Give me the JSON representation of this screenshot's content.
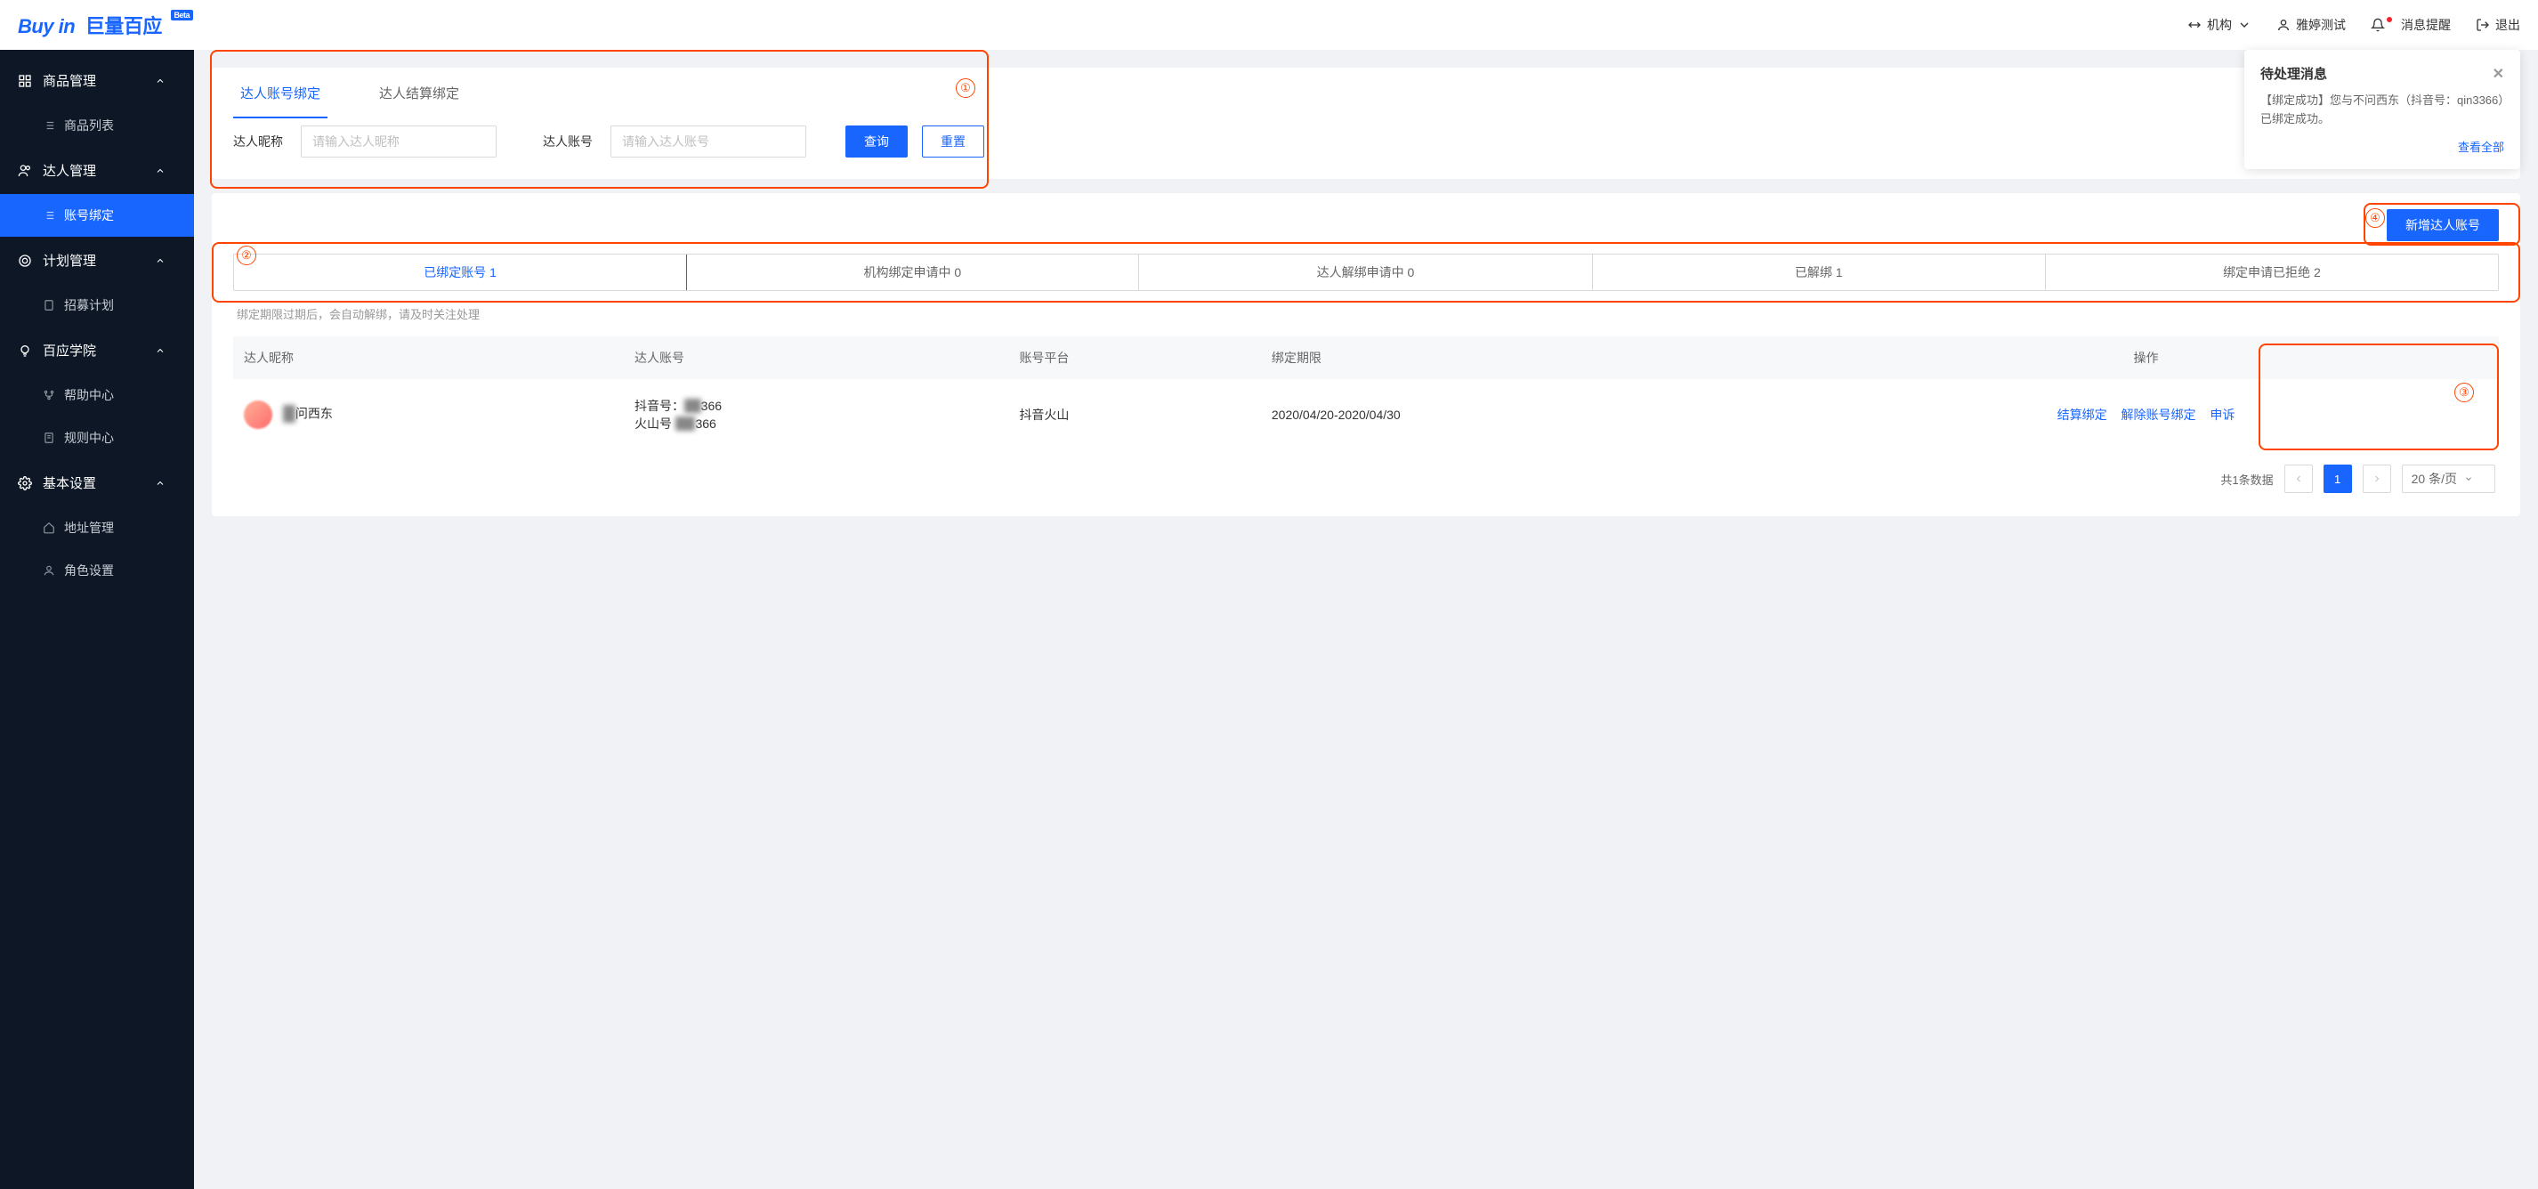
{
  "logo": {
    "en": "Buy in",
    "cn": "巨量百应",
    "badge": "Beta"
  },
  "header": {
    "org_label": "机构",
    "user": "雅婷测试",
    "notif": "消息提醒",
    "logout": "退出"
  },
  "sidebar": {
    "groups": [
      {
        "label": "商品管理",
        "items": [
          {
            "label": "商品列表"
          }
        ]
      },
      {
        "label": "达人管理",
        "items": [
          {
            "label": "账号绑定",
            "active": true
          }
        ]
      },
      {
        "label": "计划管理",
        "items": [
          {
            "label": "招募计划"
          }
        ]
      },
      {
        "label": "百应学院",
        "items": [
          {
            "label": "帮助中心"
          },
          {
            "label": "规则中心"
          }
        ]
      },
      {
        "label": "基本设置",
        "items": [
          {
            "label": "地址管理"
          },
          {
            "label": "角色设置"
          }
        ]
      }
    ]
  },
  "popover": {
    "title": "待处理消息",
    "body": "【绑定成功】您与不问西东（抖音号：qin3366）已绑定成功。",
    "view_all": "查看全部"
  },
  "tabs": [
    {
      "label": "达人账号绑定",
      "active": true
    },
    {
      "label": "达人结算绑定"
    }
  ],
  "filter": {
    "nickname_label": "达人昵称",
    "nickname_ph": "请输入达人昵称",
    "account_label": "达人账号",
    "account_ph": "请输入达人账号",
    "query": "查询",
    "reset": "重置"
  },
  "add_button": "新增达人账号",
  "status_tabs": [
    "已绑定账号 1",
    "机构绑定申请中 0",
    "达人解绑申请中 0",
    "已解绑 1",
    "绑定申请已拒绝 2"
  ],
  "hint": "绑定期限过期后，会自动解绑，请及时关注处理",
  "table": {
    "headers": [
      "达人昵称",
      "达人账号",
      "账号平台",
      "绑定期限",
      "操作"
    ],
    "row": {
      "nickname_visible": "问西东",
      "account_line1_prefix": "抖音号：",
      "account_line1_suffix": "366",
      "account_line2_prefix": "火山号",
      "account_line2_suffix": "366",
      "platform": "抖音火山",
      "period": "2020/04/20-2020/04/30",
      "ops": [
        "结算绑定",
        "解除账号绑定",
        "申诉"
      ]
    }
  },
  "pager": {
    "total": "共1条数据",
    "page": "1",
    "size": "20 条/页"
  },
  "annotations": {
    "1": "①",
    "2": "②",
    "3": "③",
    "4": "④"
  }
}
